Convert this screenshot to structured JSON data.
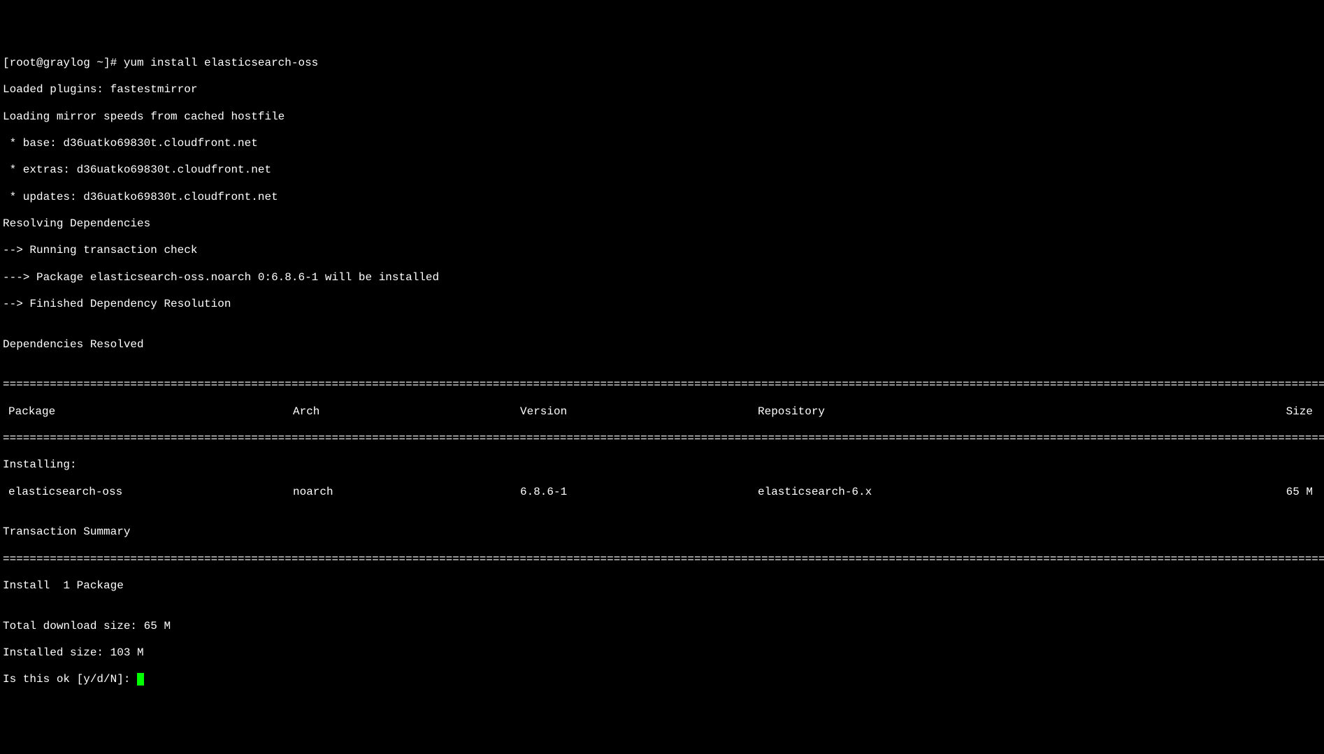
{
  "prompt": {
    "user": "[root@graylog ~]# ",
    "command": "yum install elasticsearch-oss"
  },
  "output": {
    "line1": "Loaded plugins: fastestmirror",
    "line2": "Loading mirror speeds from cached hostfile",
    "line3": " * base: d36uatko69830t.cloudfront.net",
    "line4": " * extras: d36uatko69830t.cloudfront.net",
    "line5": " * updates: d36uatko69830t.cloudfront.net",
    "line6": "Resolving Dependencies",
    "line7": "--> Running transaction check",
    "line8": "---> Package elasticsearch-oss.noarch 0:6.8.6-1 will be installed",
    "line9": "--> Finished Dependency Resolution",
    "line10": "",
    "line11": "Dependencies Resolved",
    "line12": ""
  },
  "table": {
    "headers": {
      "package": "Package",
      "arch": "Arch",
      "version": "Version",
      "repository": "Repository",
      "size": "Size"
    },
    "installing_label": "Installing:",
    "row": {
      "package": "elasticsearch-oss",
      "arch": "noarch",
      "version": "6.8.6-1",
      "repository": "elasticsearch-6.x",
      "size": "65 M"
    }
  },
  "summary": {
    "line1": "",
    "line2": "Transaction Summary",
    "line3": "",
    "line4": "Install  1 Package",
    "line5": "",
    "line6": "Total download size: 65 M",
    "line7": "Installed size: 103 M"
  },
  "confirm": {
    "text": "Is this ok [y/d/N]: "
  },
  "divider": "======================================================================================================================================================================================================================="
}
